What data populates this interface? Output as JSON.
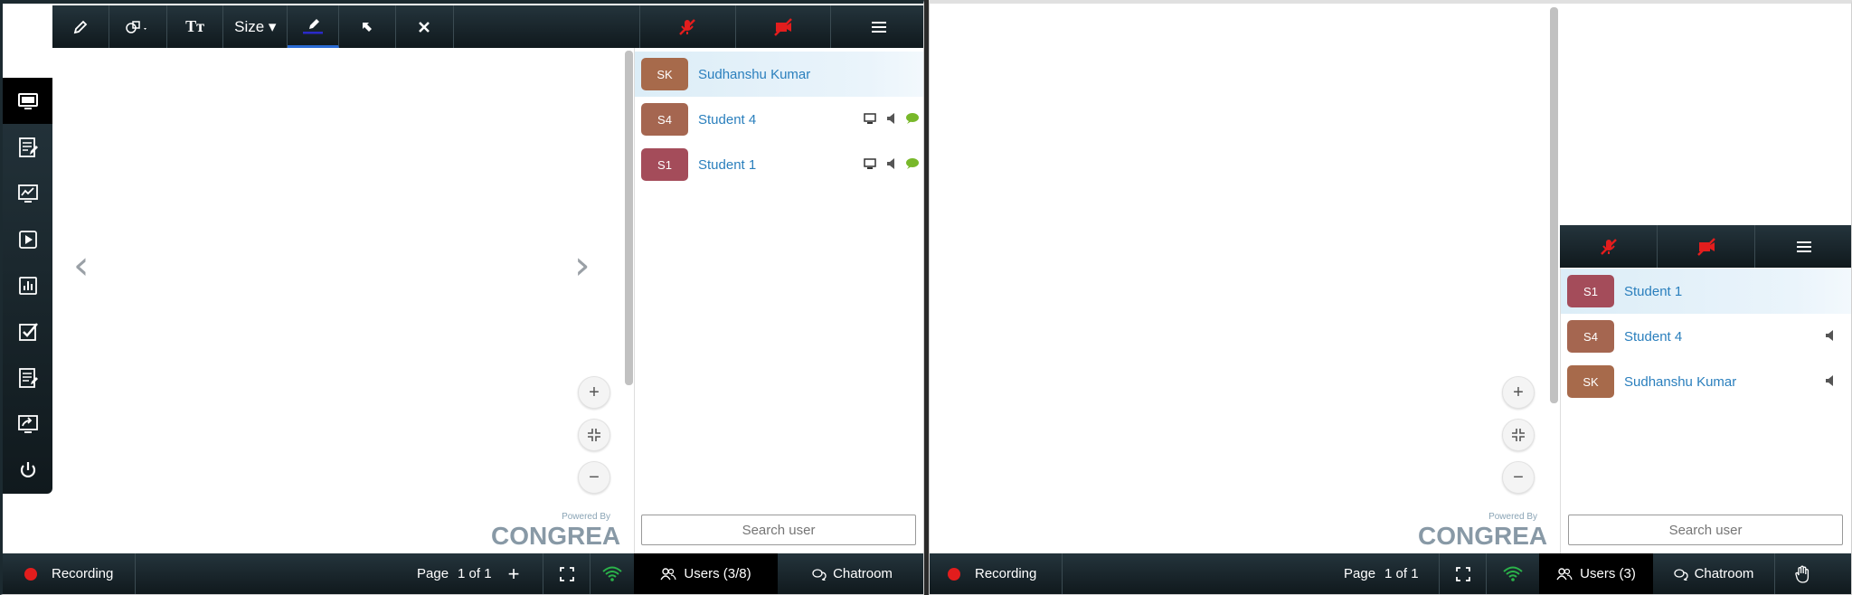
{
  "toolbar": {
    "size_label": "Size ▾",
    "text_label": "Tт",
    "pencil_color": "#2a2ac8",
    "mute_color": "#e31d1d"
  },
  "left": {
    "users": [
      {
        "initials": "SK",
        "name": "Sudhanshu Kumar",
        "color": "#a76a4b",
        "highlighted": true
      },
      {
        "initials": "S4",
        "name": "Student 4",
        "color": "#a56650"
      },
      {
        "initials": "S1",
        "name": "Student 1",
        "color": "#a44c5a"
      }
    ],
    "search_placeholder": "Search user",
    "brand_powered": "Powered By",
    "brand_name": "CONGREA",
    "bottom": {
      "recording": "Recording",
      "page_label": "Page",
      "page_value": "1 of 1",
      "users_tab": "Users (3/8)",
      "chat_tab": "Chatroom"
    }
  },
  "right": {
    "users": [
      {
        "initials": "S1",
        "name": "Student 1",
        "color": "#a44c5a",
        "highlighted": true
      },
      {
        "initials": "S4",
        "name": "Student 4",
        "color": "#a56650"
      },
      {
        "initials": "SK",
        "name": "Sudhanshu Kumar",
        "color": "#a76a4b"
      }
    ],
    "search_placeholder": "Search user",
    "brand_powered": "Powered By",
    "brand_name": "CONGREA",
    "bottom": {
      "recording": "Recording",
      "page_label": "Page",
      "page_value": "1 of 1",
      "users_tab": "Users (3)",
      "chat_tab": "Chatroom"
    }
  },
  "icons": {
    "nav": [
      "screen-share-icon",
      "editor-icon",
      "whiteboard-icon",
      "video-icon",
      "poll-icon",
      "quiz-icon",
      "notes-icon",
      "presentation-icon",
      "power-icon"
    ]
  }
}
